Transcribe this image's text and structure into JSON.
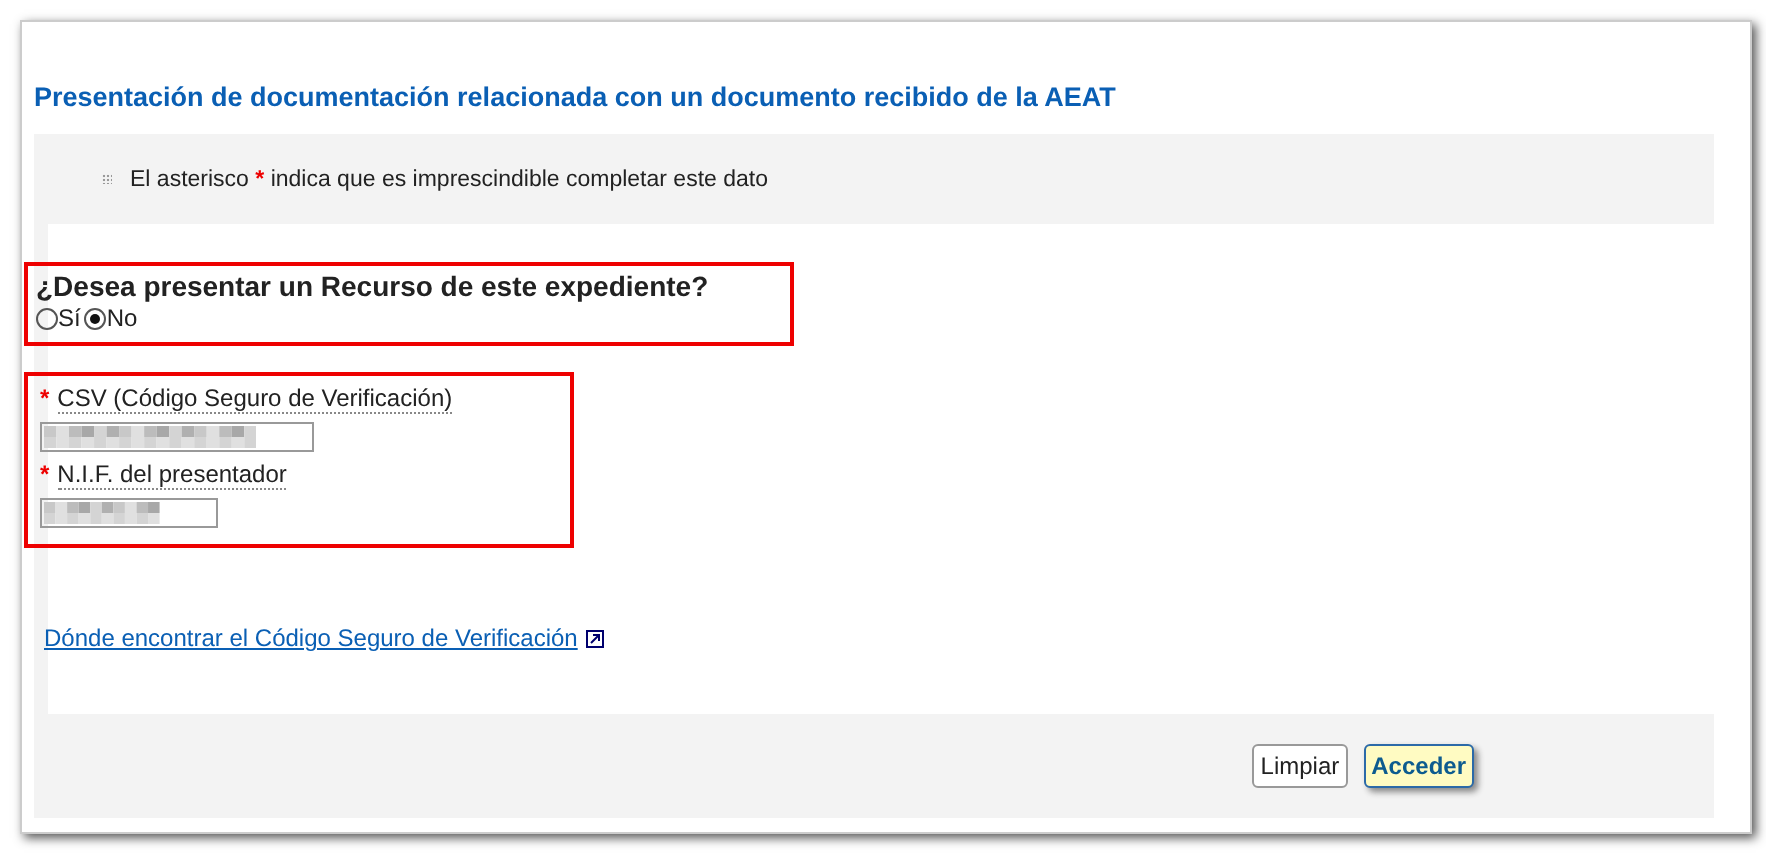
{
  "title": "Presentación de documentación relacionada con un documento recibido de la AEAT",
  "note": {
    "before": "El asterisco",
    "mark": "*",
    "after": "indica que es imprescindible completar este dato"
  },
  "question": {
    "label": "¿Desea presentar un Recurso de este expediente?",
    "options": [
      {
        "label": "Sí",
        "selected": false
      },
      {
        "label": "No",
        "selected": true
      }
    ]
  },
  "fields": [
    {
      "label": "CSV (Código Seguro de Verificación)",
      "required": true,
      "value_hidden": true,
      "kind": "long"
    },
    {
      "label": "N.I.F. del presentador",
      "required": true,
      "value_hidden": true,
      "kind": "short"
    }
  ],
  "link": "Dónde encontrar el Código Seguro de Verificación",
  "buttons": [
    {
      "label": "Limpiar",
      "kind": "secondary"
    },
    {
      "label": "Acceder",
      "kind": "primary"
    }
  ]
}
